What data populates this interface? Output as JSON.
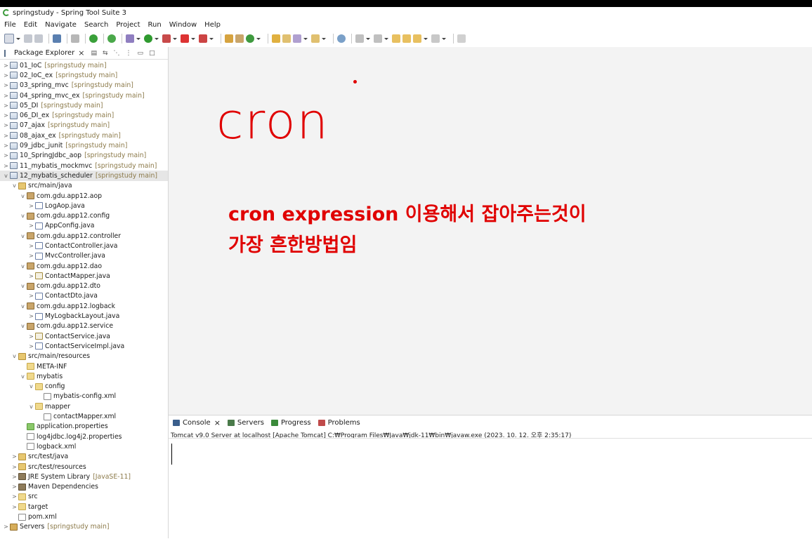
{
  "window": {
    "title": "springstudy - Spring Tool Suite 3"
  },
  "menu": [
    "File",
    "Edit",
    "Navigate",
    "Search",
    "Project",
    "Run",
    "Window",
    "Help"
  ],
  "explorer": {
    "tab_label": "Package Explorer",
    "rows": [
      {
        "indent": 0,
        "tw": ">",
        "icon": "project",
        "label": "01_IoC",
        "decor": "[springstudy main]"
      },
      {
        "indent": 0,
        "tw": ">",
        "icon": "project",
        "label": "02_IoC_ex",
        "decor": "[springstudy main]"
      },
      {
        "indent": 0,
        "tw": ">",
        "icon": "project",
        "label": "03_spring_mvc",
        "decor": "[springstudy main]"
      },
      {
        "indent": 0,
        "tw": ">",
        "icon": "project",
        "label": "04_spring_mvc_ex",
        "decor": "[springstudy main]"
      },
      {
        "indent": 0,
        "tw": ">",
        "icon": "project",
        "label": "05_DI",
        "decor": "[springstudy main]"
      },
      {
        "indent": 0,
        "tw": ">",
        "icon": "project",
        "label": "06_DI_ex",
        "decor": "[springstudy main]"
      },
      {
        "indent": 0,
        "tw": ">",
        "icon": "project",
        "label": "07_ajax",
        "decor": "[springstudy main]"
      },
      {
        "indent": 0,
        "tw": ">",
        "icon": "project",
        "label": "08_ajax_ex",
        "decor": "[springstudy main]"
      },
      {
        "indent": 0,
        "tw": ">",
        "icon": "project",
        "label": "09_jdbc_junit",
        "decor": "[springstudy main]"
      },
      {
        "indent": 0,
        "tw": ">",
        "icon": "project",
        "label": "10_SpringJdbc_aop",
        "decor": "[springstudy main]"
      },
      {
        "indent": 0,
        "tw": ">",
        "icon": "project",
        "label": "11_mybatis_mockmvc",
        "decor": "[springstudy main]"
      },
      {
        "indent": 0,
        "tw": "v",
        "icon": "project",
        "label": "12_mybatis_scheduler",
        "decor": "[springstudy main]",
        "selected": true
      },
      {
        "indent": 1,
        "tw": "v",
        "icon": "srcfolder",
        "label": "src/main/java"
      },
      {
        "indent": 2,
        "tw": "v",
        "icon": "package",
        "label": "com.gdu.app12.aop"
      },
      {
        "indent": 3,
        "tw": ">",
        "icon": "java",
        "label": "LogAop.java"
      },
      {
        "indent": 2,
        "tw": "v",
        "icon": "package",
        "label": "com.gdu.app12.config"
      },
      {
        "indent": 3,
        "tw": ">",
        "icon": "java",
        "label": "AppConfig.java"
      },
      {
        "indent": 2,
        "tw": "v",
        "icon": "package",
        "label": "com.gdu.app12.controller"
      },
      {
        "indent": 3,
        "tw": ">",
        "icon": "java",
        "label": "ContactController.java"
      },
      {
        "indent": 3,
        "tw": ">",
        "icon": "java",
        "label": "MvcController.java"
      },
      {
        "indent": 2,
        "tw": "v",
        "icon": "package",
        "label": "com.gdu.app12.dao"
      },
      {
        "indent": 3,
        "tw": ">",
        "icon": "iface",
        "label": "ContactMapper.java"
      },
      {
        "indent": 2,
        "tw": "v",
        "icon": "package",
        "label": "com.gdu.app12.dto"
      },
      {
        "indent": 3,
        "tw": ">",
        "icon": "java",
        "label": "ContactDto.java"
      },
      {
        "indent": 2,
        "tw": "v",
        "icon": "package",
        "label": "com.gdu.app12.logback"
      },
      {
        "indent": 3,
        "tw": ">",
        "icon": "java",
        "label": "MyLogbackLayout.java"
      },
      {
        "indent": 2,
        "tw": "v",
        "icon": "package",
        "label": "com.gdu.app12.service"
      },
      {
        "indent": 3,
        "tw": ">",
        "icon": "iface",
        "label": "ContactService.java"
      },
      {
        "indent": 3,
        "tw": ">",
        "icon": "java",
        "label": "ContactServiceImpl.java"
      },
      {
        "indent": 1,
        "tw": "v",
        "icon": "srcfolder",
        "label": "src/main/resources"
      },
      {
        "indent": 2,
        "tw": "",
        "icon": "folder",
        "label": "META-INF"
      },
      {
        "indent": 2,
        "tw": "v",
        "icon": "folder",
        "label": "mybatis"
      },
      {
        "indent": 3,
        "tw": "v",
        "icon": "folder",
        "label": "config"
      },
      {
        "indent": 4,
        "tw": "",
        "icon": "xml",
        "label": "mybatis-config.xml"
      },
      {
        "indent": 3,
        "tw": "v",
        "icon": "folder",
        "label": "mapper"
      },
      {
        "indent": 4,
        "tw": "",
        "icon": "xml",
        "label": "contactMapper.xml"
      },
      {
        "indent": 2,
        "tw": "",
        "icon": "props",
        "label": "application.properties"
      },
      {
        "indent": 2,
        "tw": "",
        "icon": "xml",
        "label": "log4jdbc.log4j2.properties"
      },
      {
        "indent": 2,
        "tw": "",
        "icon": "xml",
        "label": "logback.xml"
      },
      {
        "indent": 1,
        "tw": ">",
        "icon": "srcfolder",
        "label": "src/test/java"
      },
      {
        "indent": 1,
        "tw": ">",
        "icon": "srcfolder",
        "label": "src/test/resources"
      },
      {
        "indent": 1,
        "tw": ">",
        "icon": "lib",
        "label": "JRE System Library",
        "decor": "[JavaSE-11]"
      },
      {
        "indent": 1,
        "tw": ">",
        "icon": "lib",
        "label": "Maven Dependencies"
      },
      {
        "indent": 1,
        "tw": ">",
        "icon": "folder",
        "label": "src"
      },
      {
        "indent": 1,
        "tw": ">",
        "icon": "folder",
        "label": "target"
      },
      {
        "indent": 1,
        "tw": "",
        "icon": "xml",
        "label": "pom.xml"
      },
      {
        "indent": 0,
        "tw": ">",
        "icon": "server",
        "label": "Servers",
        "decor": "[springstudy main]"
      }
    ]
  },
  "editor": {
    "big_text": "cron",
    "note_line1": "cron expression 이용해서 잡아주는것이",
    "note_line2": "가장 흔한방법임",
    "accent_color": "#e00000"
  },
  "console": {
    "tabs": [
      {
        "label": "Console",
        "active": true
      },
      {
        "label": "Servers"
      },
      {
        "label": "Progress"
      },
      {
        "label": "Problems"
      }
    ],
    "description": "Tomcat v9.0 Server at localhost [Apache Tomcat] C:₩Program Files₩Java₩jdk-11₩bin₩javaw.exe  (2023. 10. 12. 오후 2:35:17)"
  }
}
